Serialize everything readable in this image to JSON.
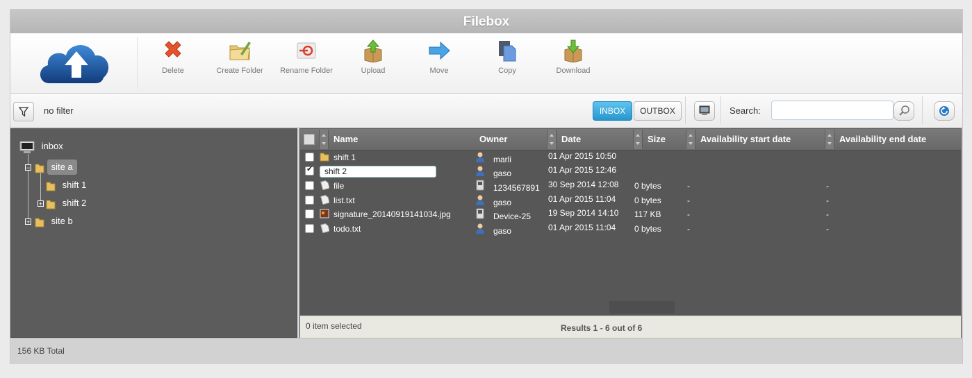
{
  "app": {
    "title": "Filebox"
  },
  "toolbar": {
    "buttons": [
      {
        "label": "Delete",
        "icon": "delete-x-icon"
      },
      {
        "label": "Create Folder",
        "icon": "create-folder-icon"
      },
      {
        "label": "Rename Folder",
        "icon": "rename-folder-icon"
      },
      {
        "label": "Upload",
        "icon": "upload-icon"
      },
      {
        "label": "Move",
        "icon": "move-arrow-icon"
      },
      {
        "label": "Copy",
        "icon": "copy-icon"
      },
      {
        "label": "Download",
        "icon": "download-icon"
      }
    ]
  },
  "filter": {
    "label": "no filter"
  },
  "mailbox": {
    "inbox_label": "INBOX",
    "outbox_label": "OUTBOX",
    "active": "INBOX"
  },
  "search": {
    "label": "Search:",
    "value": ""
  },
  "tree": {
    "root": "inbox",
    "items": [
      {
        "label": "site a",
        "selected": true
      },
      {
        "label": "shift 1"
      },
      {
        "label": "shift 2"
      },
      {
        "label": "site b"
      }
    ]
  },
  "grid": {
    "columns": [
      "Name",
      "Owner",
      "Date",
      "Size",
      "Availability start date",
      "Availability end date"
    ],
    "rows": [
      {
        "name": "shift 1",
        "type": "folder",
        "owner": "marli",
        "owner_type": "user",
        "date": "01 Apr 2015 10:50",
        "size": "",
        "start": "",
        "end": "",
        "checked": false,
        "editing": false
      },
      {
        "name": "shift 2",
        "type": "folder",
        "owner": "gaso",
        "owner_type": "user",
        "date": "01 Apr 2015 12:46",
        "size": "",
        "start": "",
        "end": "",
        "checked": true,
        "editing": true
      },
      {
        "name": "file",
        "type": "file",
        "owner": "1234567891",
        "owner_type": "device",
        "date": "30 Sep 2014 12:08",
        "size": "0 bytes",
        "start": "-",
        "end": "-",
        "checked": false,
        "editing": false
      },
      {
        "name": "list.txt",
        "type": "file",
        "owner": "gaso",
        "owner_type": "user",
        "date": "01 Apr 2015 11:04",
        "size": "0 bytes",
        "start": "-",
        "end": "-",
        "checked": false,
        "editing": false
      },
      {
        "name": "signature_20140919141034.jpg",
        "type": "image",
        "owner": "Device-25",
        "owner_type": "device",
        "date": "19 Sep 2014 14:10",
        "size": "117 KB",
        "start": "-",
        "end": "-",
        "checked": false,
        "editing": false
      },
      {
        "name": "todo.txt",
        "type": "file",
        "owner": "gaso",
        "owner_type": "user",
        "date": "01 Apr 2015 11:04",
        "size": "0 bytes",
        "start": "-",
        "end": "-",
        "checked": false,
        "editing": false
      }
    ],
    "selected_text": "0 item selected",
    "results_text": "Results 1 - 6 out of 6"
  },
  "status": {
    "total": "156 KB Total"
  },
  "colors": {
    "accent": "#2796cf",
    "panel": "#5c5c5c",
    "header": "#6e6e6e"
  }
}
